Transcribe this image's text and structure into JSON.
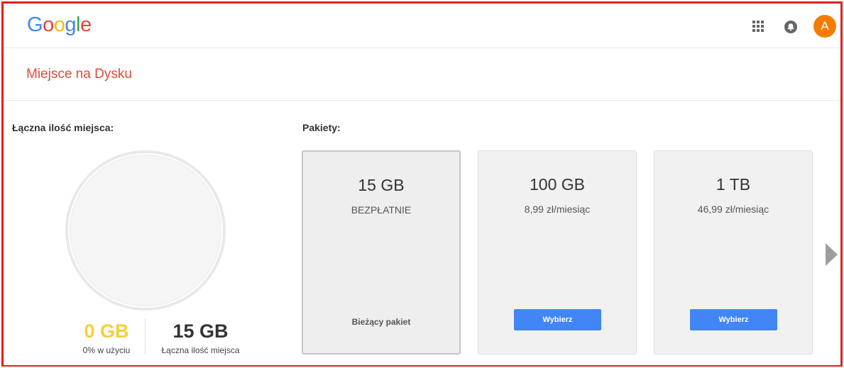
{
  "colors": {
    "title_red": "#dd4b39",
    "used_yellow": "#f4cf3a",
    "button_blue": "#4285f4",
    "avatar_orange": "#f57c00",
    "logo": [
      "#4285f4",
      "#ea4335",
      "#fbbc05",
      "#4285f4",
      "#34a853",
      "#ea4335"
    ]
  },
  "header": {
    "logo_letters": [
      "G",
      "o",
      "o",
      "g",
      "l",
      "e"
    ],
    "apps_icon": "apps-grid-icon",
    "notifications_icon": "bell-icon",
    "avatar_letter": "A"
  },
  "page": {
    "title": "Miejsce na Dysku"
  },
  "storage": {
    "heading": "Łączna ilość miejsca:",
    "used_value": "0 GB",
    "used_caption": "0% w użyciu",
    "total_value": "15 GB",
    "total_caption": "Łączna ilość miejsca",
    "used_fraction": 0
  },
  "packages": {
    "heading": "Pakiety:",
    "items": [
      {
        "size": "15 GB",
        "price": "BEZPŁATNIE",
        "status": "Bieżący pakiet"
      },
      {
        "size": "100 GB",
        "price": "8,99 zł/miesiąc",
        "button": "Wybierz"
      },
      {
        "size": "1 TB",
        "price": "46,99 zł/miesiąc",
        "button": "Wybierz"
      }
    ],
    "next_icon": "chevron-right-icon"
  }
}
